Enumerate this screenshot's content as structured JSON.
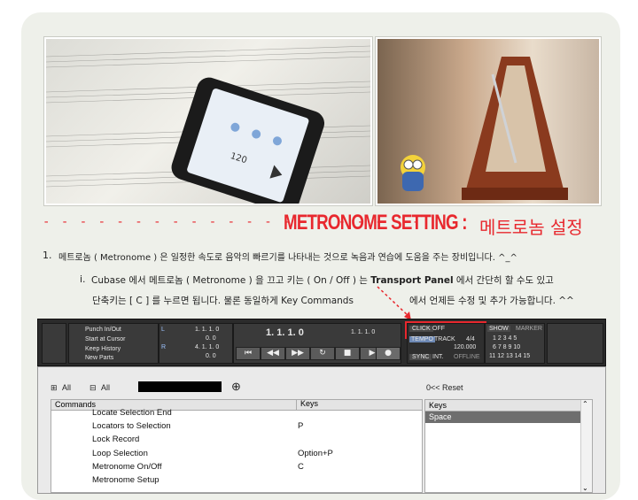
{
  "heading": {
    "dashes": "- - - - - - - - - - - - - - - - - - - - -",
    "title": "METRONOME SETTING :",
    "subtitle": "메트로놈 설정"
  },
  "paragraphs": {
    "p1_num": "1.",
    "p1_text": "메트로놈 ( Metronome ) 은 일정한 속도로 음악의 빠르기를 나타내는 것으로 녹음과 연습에 도움을 주는 장비입니다. ^_^",
    "p2_num": "i.",
    "p2_part1": "Cubase 에서 메트로놈 ( Metronome ) 을 끄고 키는 ( On / Off ) 는 ",
    "p2_bold": "Transport Panel",
    "p2_part2": " 에서 간단히 할 수도 있고",
    "p3_part1": "단축키는 [ C ] 를 누르면 됩니다. 물론 동일하게 ",
    "p3_bold": "Key Commands",
    "p3_part2": "에서 언제든 수정 및 추가 가능합니다. ^^"
  },
  "transport": {
    "punch": "Punch In/Out",
    "start": "Start at Cursor",
    "keep": "Keep History",
    "new_parts": "New Parts",
    "mode_l": "L",
    "mode_r": "R",
    "pos_top": "1.  1.  1.    0",
    "pos_mid": "0.    0",
    "pos_bot": "4.  1.  1.    0",
    "pos_bot2": "0.    0",
    "main_pos": "1.   1.   1.     0",
    "main_pos2": "1.   1.   1.   0",
    "click_label": "CLICK",
    "click_state": "OFF",
    "tempo_label": "TEMPO",
    "track_label": "TRACK",
    "sig": "4/4",
    "bpm": "120.000",
    "sync_label": "SYNC",
    "int_label": "INT.",
    "offline": "OFFLINE",
    "show": "SHOW",
    "marker": "MARKER",
    "markers_row1": "1  2  3  4  5",
    "markers_row2": "6  7  8  9  10",
    "markers_row3": "11 12 13 14 15"
  },
  "keycmd": {
    "all_expand": "All",
    "all_collapse": "All",
    "reset": "0<< Reset",
    "col_commands": "Commands",
    "col_keys": "Keys",
    "rows": [
      {
        "cmd": "Locate Selection End",
        "key": ""
      },
      {
        "cmd": "Locators to Selection",
        "key": "P"
      },
      {
        "cmd": "Lock Record",
        "key": ""
      },
      {
        "cmd": "Loop Selection",
        "key": "Option+P"
      },
      {
        "cmd": "Metronome On/Off",
        "key": "C"
      },
      {
        "cmd": "Metronome Setup",
        "key": ""
      }
    ],
    "keys_header": "Keys",
    "keys_selected": "Space"
  }
}
